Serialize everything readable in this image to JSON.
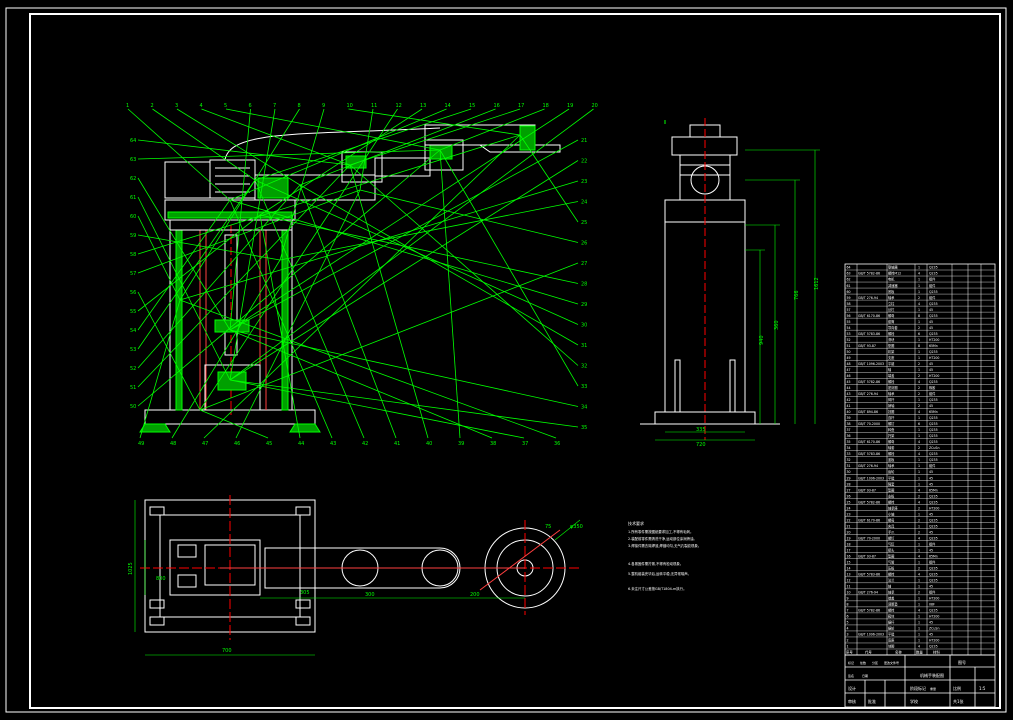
{
  "drawing": {
    "background": "#000000",
    "colors": {
      "frame": "#ffffff",
      "leader": "#00ff00",
      "part": "#ffffff",
      "centerline": "#ff0000",
      "section_fill": "#00c000"
    },
    "views": [
      "front-section-view",
      "side-view",
      "plan-view",
      "technical-notes",
      "parts-list",
      "title-block"
    ]
  },
  "front_view": {
    "balloons_top": [
      "1",
      "2",
      "3",
      "4",
      "5",
      "6",
      "7",
      "8",
      "9",
      "10",
      "11",
      "12",
      "13",
      "14",
      "15",
      "16",
      "17",
      "18",
      "19",
      "20"
    ],
    "balloons_left": [
      "64",
      "63",
      "62",
      "61",
      "60",
      "59",
      "58",
      "57",
      "56",
      "55",
      "54",
      "53",
      "52",
      "51",
      "50"
    ],
    "balloons_right": [
      "21",
      "22",
      "23",
      "24",
      "25",
      "26",
      "27",
      "28",
      "29",
      "30",
      "31",
      "32",
      "33",
      "34",
      "35"
    ],
    "balloons_bottom": [
      "49",
      "48",
      "47",
      "46",
      "45",
      "44",
      "43",
      "42",
      "41",
      "40",
      "39",
      "38",
      "37",
      "36"
    ]
  },
  "side_view": {
    "dims": [
      "1612",
      "766",
      "360",
      "940"
    ],
    "width_dims": [
      "335",
      "720"
    ]
  },
  "plan_view": {
    "dims_bottom": [
      "305",
      "300",
      "200"
    ],
    "dims_left": [
      "1025",
      "800"
    ],
    "dims_right": [
      "φ350",
      "75"
    ],
    "dim_overall": "700"
  },
  "notes": {
    "title": "技术要求",
    "lines": [
      "1.所有零件需按图纸要求加工,不得有毛刺。",
      "2.装配前零件需清洗干净,运动部位涂润滑油。",
      "3.焊接件需去除焊渣,焊缝均匀,无气孔裂纹现象。",
      "4.各紧固件需拧紧,不得有松动现象。",
      "5.整机组装完毕后,运转平稳,无异常噪声。",
      "6.未注尺寸公差按GB/T1804-m执行。"
    ]
  },
  "parts_list": {
    "rows": [
      {
        "no": "64",
        "std": "",
        "name": "联轴器",
        "qty": "1",
        "mat": "Q235"
      },
      {
        "no": "63",
        "std": "GB/T 5782-86",
        "name": "螺栓M12",
        "qty": "4",
        "mat": "Q235"
      },
      {
        "no": "62",
        "std": "",
        "name": "电机",
        "qty": "1",
        "mat": "组件"
      },
      {
        "no": "61",
        "std": "",
        "name": "减速器",
        "qty": "1",
        "mat": "组件"
      },
      {
        "no": "60",
        "std": "",
        "name": "底板",
        "qty": "1",
        "mat": "Q235"
      },
      {
        "no": "59",
        "std": "GB/T 276-94",
        "name": "轴承",
        "qty": "2",
        "mat": "组件"
      },
      {
        "no": "58",
        "std": "",
        "name": "立柱",
        "qty": "4",
        "mat": "Q235"
      },
      {
        "no": "57",
        "std": "",
        "name": "丝杠",
        "qty": "1",
        "mat": "45"
      },
      {
        "no": "56",
        "std": "GB/T 6170-86",
        "name": "螺母",
        "qty": "8",
        "mat": "Q235"
      },
      {
        "no": "55",
        "std": "",
        "name": "套筒",
        "qty": "1",
        "mat": "45"
      },
      {
        "no": "54",
        "std": "",
        "name": "导向套",
        "qty": "2",
        "mat": "45"
      },
      {
        "no": "53",
        "std": "GB/T 5783-86",
        "name": "螺栓",
        "qty": "6",
        "mat": "Q235"
      },
      {
        "no": "52",
        "std": "",
        "name": "滑块",
        "qty": "1",
        "mat": "HT200"
      },
      {
        "no": "51",
        "std": "GB/T 93-87",
        "name": "垫圈",
        "qty": "8",
        "mat": "65Mn"
      },
      {
        "no": "50",
        "std": "",
        "name": "机架",
        "qty": "1",
        "mat": "Q235"
      },
      {
        "no": "49",
        "std": "",
        "name": "支座",
        "qty": "1",
        "mat": "HT200"
      },
      {
        "no": "48",
        "std": "GB/T 1096-2003",
        "name": "平键",
        "qty": "2",
        "mat": "45"
      },
      {
        "no": "47",
        "std": "",
        "name": "轴",
        "qty": "1",
        "mat": "45"
      },
      {
        "no": "46",
        "std": "",
        "name": "端盖",
        "qty": "2",
        "mat": "HT200"
      },
      {
        "no": "45",
        "std": "GB/T 5782-86",
        "name": "螺栓",
        "qty": "4",
        "mat": "Q235"
      },
      {
        "no": "44",
        "std": "",
        "name": "密封圈",
        "qty": "2",
        "mat": "橡胶"
      },
      {
        "no": "43",
        "std": "GB/T 276-94",
        "name": "轴承",
        "qty": "2",
        "mat": "组件"
      },
      {
        "no": "42",
        "std": "",
        "name": "臂杆",
        "qty": "1",
        "mat": "Q235"
      },
      {
        "no": "41",
        "std": "",
        "name": "销轴",
        "qty": "2",
        "mat": "45"
      },
      {
        "no": "40",
        "std": "GB/T 894-86",
        "name": "挡圈",
        "qty": "4",
        "mat": "65Mn"
      },
      {
        "no": "39",
        "std": "",
        "name": "连杆",
        "qty": "1",
        "mat": "Q235"
      },
      {
        "no": "38",
        "std": "GB/T 70-2000",
        "name": "螺钉",
        "qty": "6",
        "mat": "Q235"
      },
      {
        "no": "37",
        "std": "",
        "name": "转盘",
        "qty": "1",
        "mat": "Q235"
      },
      {
        "no": "36",
        "std": "",
        "name": "托架",
        "qty": "1",
        "mat": "Q235"
      },
      {
        "no": "35",
        "std": "GB/T 6170-86",
        "name": "螺母",
        "qty": "4",
        "mat": "Q235"
      },
      {
        "no": "34",
        "std": "",
        "name": "轴套",
        "qty": "2",
        "mat": "ZCuSn"
      },
      {
        "no": "33",
        "std": "GB/T 5783-86",
        "name": "螺栓",
        "qty": "4",
        "mat": "Q235"
      },
      {
        "no": "32",
        "std": "",
        "name": "盖板",
        "qty": "1",
        "mat": "Q235"
      },
      {
        "no": "31",
        "std": "GB/T 276-94",
        "name": "轴承",
        "qty": "1",
        "mat": "组件"
      },
      {
        "no": "30",
        "std": "",
        "name": "齿轮",
        "qty": "1",
        "mat": "45"
      },
      {
        "no": "29",
        "std": "GB/T 1096-2003",
        "name": "平键",
        "qty": "1",
        "mat": "45"
      },
      {
        "no": "28",
        "std": "",
        "name": "隔套",
        "qty": "1",
        "mat": "45"
      },
      {
        "no": "27",
        "std": "GB/T 93-87",
        "name": "垫圈",
        "qty": "4",
        "mat": "65Mn"
      },
      {
        "no": "26",
        "std": "",
        "name": "支板",
        "qty": "2",
        "mat": "Q235"
      },
      {
        "no": "25",
        "std": "GB/T 5782-86",
        "name": "螺栓",
        "qty": "4",
        "mat": "Q235"
      },
      {
        "no": "24",
        "std": "",
        "name": "轴承座",
        "qty": "2",
        "mat": "HT200"
      },
      {
        "no": "23",
        "std": "",
        "name": "小轴",
        "qty": "1",
        "mat": "45"
      },
      {
        "no": "22",
        "std": "GB/T 6170-86",
        "name": "螺母",
        "qty": "2",
        "mat": "Q235"
      },
      {
        "no": "21",
        "std": "",
        "name": "夹具",
        "qty": "1",
        "mat": "Q235"
      },
      {
        "no": "20",
        "std": "",
        "name": "手爪",
        "qty": "2",
        "mat": "45"
      },
      {
        "no": "19",
        "std": "GB/T 70-2000",
        "name": "螺钉",
        "qty": "4",
        "mat": "Q235"
      },
      {
        "no": "18",
        "std": "",
        "name": "气缸",
        "qty": "1",
        "mat": "组件"
      },
      {
        "no": "17",
        "std": "",
        "name": "接头",
        "qty": "1",
        "mat": "45"
      },
      {
        "no": "16",
        "std": "GB/T 93-87",
        "name": "垫圈",
        "qty": "4",
        "mat": "65Mn"
      },
      {
        "no": "15",
        "std": "",
        "name": "气管",
        "qty": "1",
        "mat": "组件"
      },
      {
        "no": "14",
        "std": "",
        "name": "压板",
        "qty": "2",
        "mat": "Q235"
      },
      {
        "no": "13",
        "std": "GB/T 5783-86",
        "name": "螺栓",
        "qty": "4",
        "mat": "Q235"
      },
      {
        "no": "12",
        "std": "",
        "name": "法兰",
        "qty": "1",
        "mat": "Q235"
      },
      {
        "no": "11",
        "std": "",
        "name": "轴",
        "qty": "1",
        "mat": "45"
      },
      {
        "no": "10",
        "std": "GB/T 276-94",
        "name": "轴承",
        "qty": "2",
        "mat": "组件"
      },
      {
        "no": "9",
        "std": "",
        "name": "端盖",
        "qty": "1",
        "mat": "HT200"
      },
      {
        "no": "8",
        "std": "",
        "name": "调整垫",
        "qty": "1",
        "mat": "08F"
      },
      {
        "no": "7",
        "std": "GB/T 5782-86",
        "name": "螺栓",
        "qty": "4",
        "mat": "Q235"
      },
      {
        "no": "6",
        "std": "",
        "name": "箱体",
        "qty": "1",
        "mat": "HT200"
      },
      {
        "no": "5",
        "std": "",
        "name": "蜗杆",
        "qty": "1",
        "mat": "45"
      },
      {
        "no": "4",
        "std": "",
        "name": "蜗轮",
        "qty": "1",
        "mat": "ZCuSn"
      },
      {
        "no": "3",
        "std": "GB/T 1096-2003",
        "name": "平键",
        "qty": "1",
        "mat": "45"
      },
      {
        "no": "2",
        "std": "",
        "name": "底座",
        "qty": "1",
        "mat": "HT200"
      },
      {
        "no": "1",
        "std": "",
        "name": "地脚",
        "qty": "4",
        "mat": "Q235"
      }
    ],
    "header": {
      "no": "序号",
      "std": "代号",
      "name": "名称",
      "qty": "数量",
      "mat": "材料"
    }
  },
  "title_block": {
    "title": "机械手装配图",
    "drawing_no": "图号",
    "scale": "1:5",
    "sheet": "共1张",
    "designer": "设计",
    "checker": "审核",
    "approver": "批准",
    "school": "学校",
    "labels": [
      "标记",
      "处数",
      "分区",
      "更改文件号",
      "签名",
      "日期"
    ],
    "stage": "阶段标记",
    "weight": "重量",
    "ratio": "比例"
  }
}
